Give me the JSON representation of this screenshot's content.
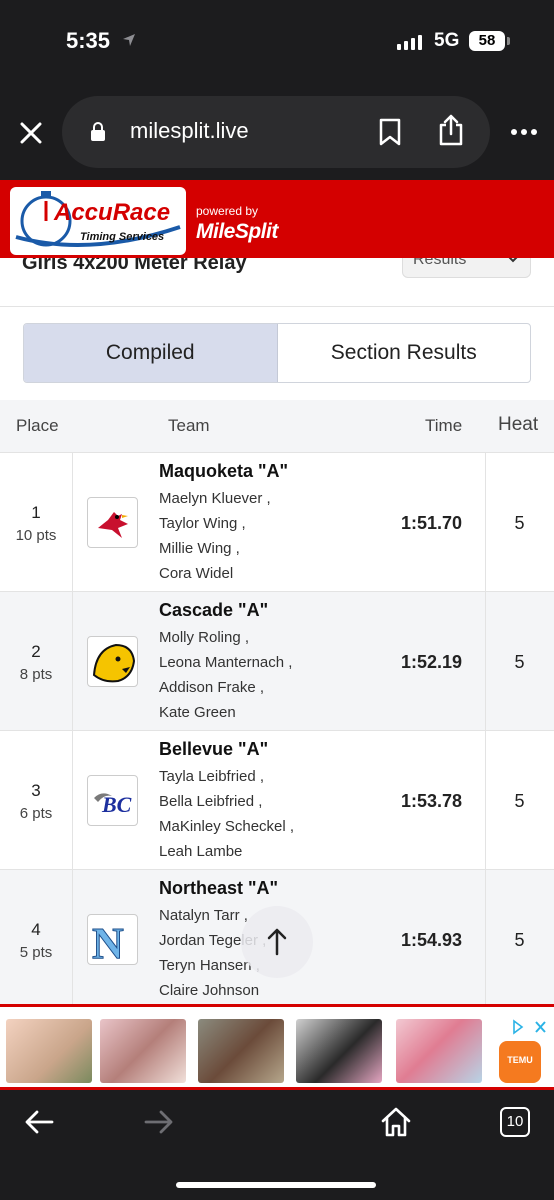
{
  "status": {
    "time": "5:35",
    "network": "5G",
    "battery": "58"
  },
  "browser": {
    "url": "milesplit.live",
    "icons": [
      "close-icon",
      "lock-icon",
      "bookmark-icon",
      "share-icon",
      "more-icon"
    ]
  },
  "header": {
    "accurace_brand": "AccuRace",
    "accurace_sub": "Timing Services",
    "powered_by": "powered by",
    "milesplit_brand": "MileSplit",
    "colors": {
      "band": "#d40000",
      "accurace_blue": "#1a5aa8"
    }
  },
  "event": {
    "title": "Girls 4x200 Meter Relay",
    "results_select": "Results"
  },
  "tabs": [
    {
      "label": "Compiled",
      "active": true
    },
    {
      "label": "Section Results",
      "active": false
    }
  ],
  "table": {
    "columns": {
      "place": "Place",
      "team": "Team",
      "time": "Time",
      "heat": "Heat"
    },
    "rows": [
      {
        "place": "1",
        "points": "10 pts",
        "team": "Maquoketa \"A\"",
        "athletes": [
          "Maelyn Kluever ,",
          "Taylor Wing ,",
          "Millie Wing ,",
          "Cora Widel"
        ],
        "time": "1:51.70",
        "heat": "5",
        "logo": "cardinal-logo-icon"
      },
      {
        "place": "2",
        "points": "8 pts",
        "team": "Cascade \"A\"",
        "athletes": [
          "Molly Roling ,",
          "Leona Manternach ,",
          "Addison Frake ,",
          "Kate Green"
        ],
        "time": "1:52.19",
        "heat": "5",
        "logo": "cougar-logo-icon"
      },
      {
        "place": "3",
        "points": "6 pts",
        "team": "Bellevue \"A\"",
        "athletes": [
          "Tayla Leibfried ,",
          "Bella Leibfried ,",
          "MaKinley Scheckel ,",
          "Leah Lambe"
        ],
        "time": "1:53.78",
        "heat": "5",
        "logo": "bc-logo-icon"
      },
      {
        "place": "4",
        "points": "5 pts",
        "team": "Northeast \"A\"",
        "athletes": [
          "Natalyn Tarr ,",
          "Jordan Tegeler ,",
          "Teryn Hansen ,",
          "Claire Johnson"
        ],
        "time": "1:54.93",
        "heat": "5",
        "logo": "n-logo-icon"
      }
    ]
  },
  "ad": {
    "brand": "TEMU"
  },
  "toolbar": {
    "tab_count": "10"
  }
}
